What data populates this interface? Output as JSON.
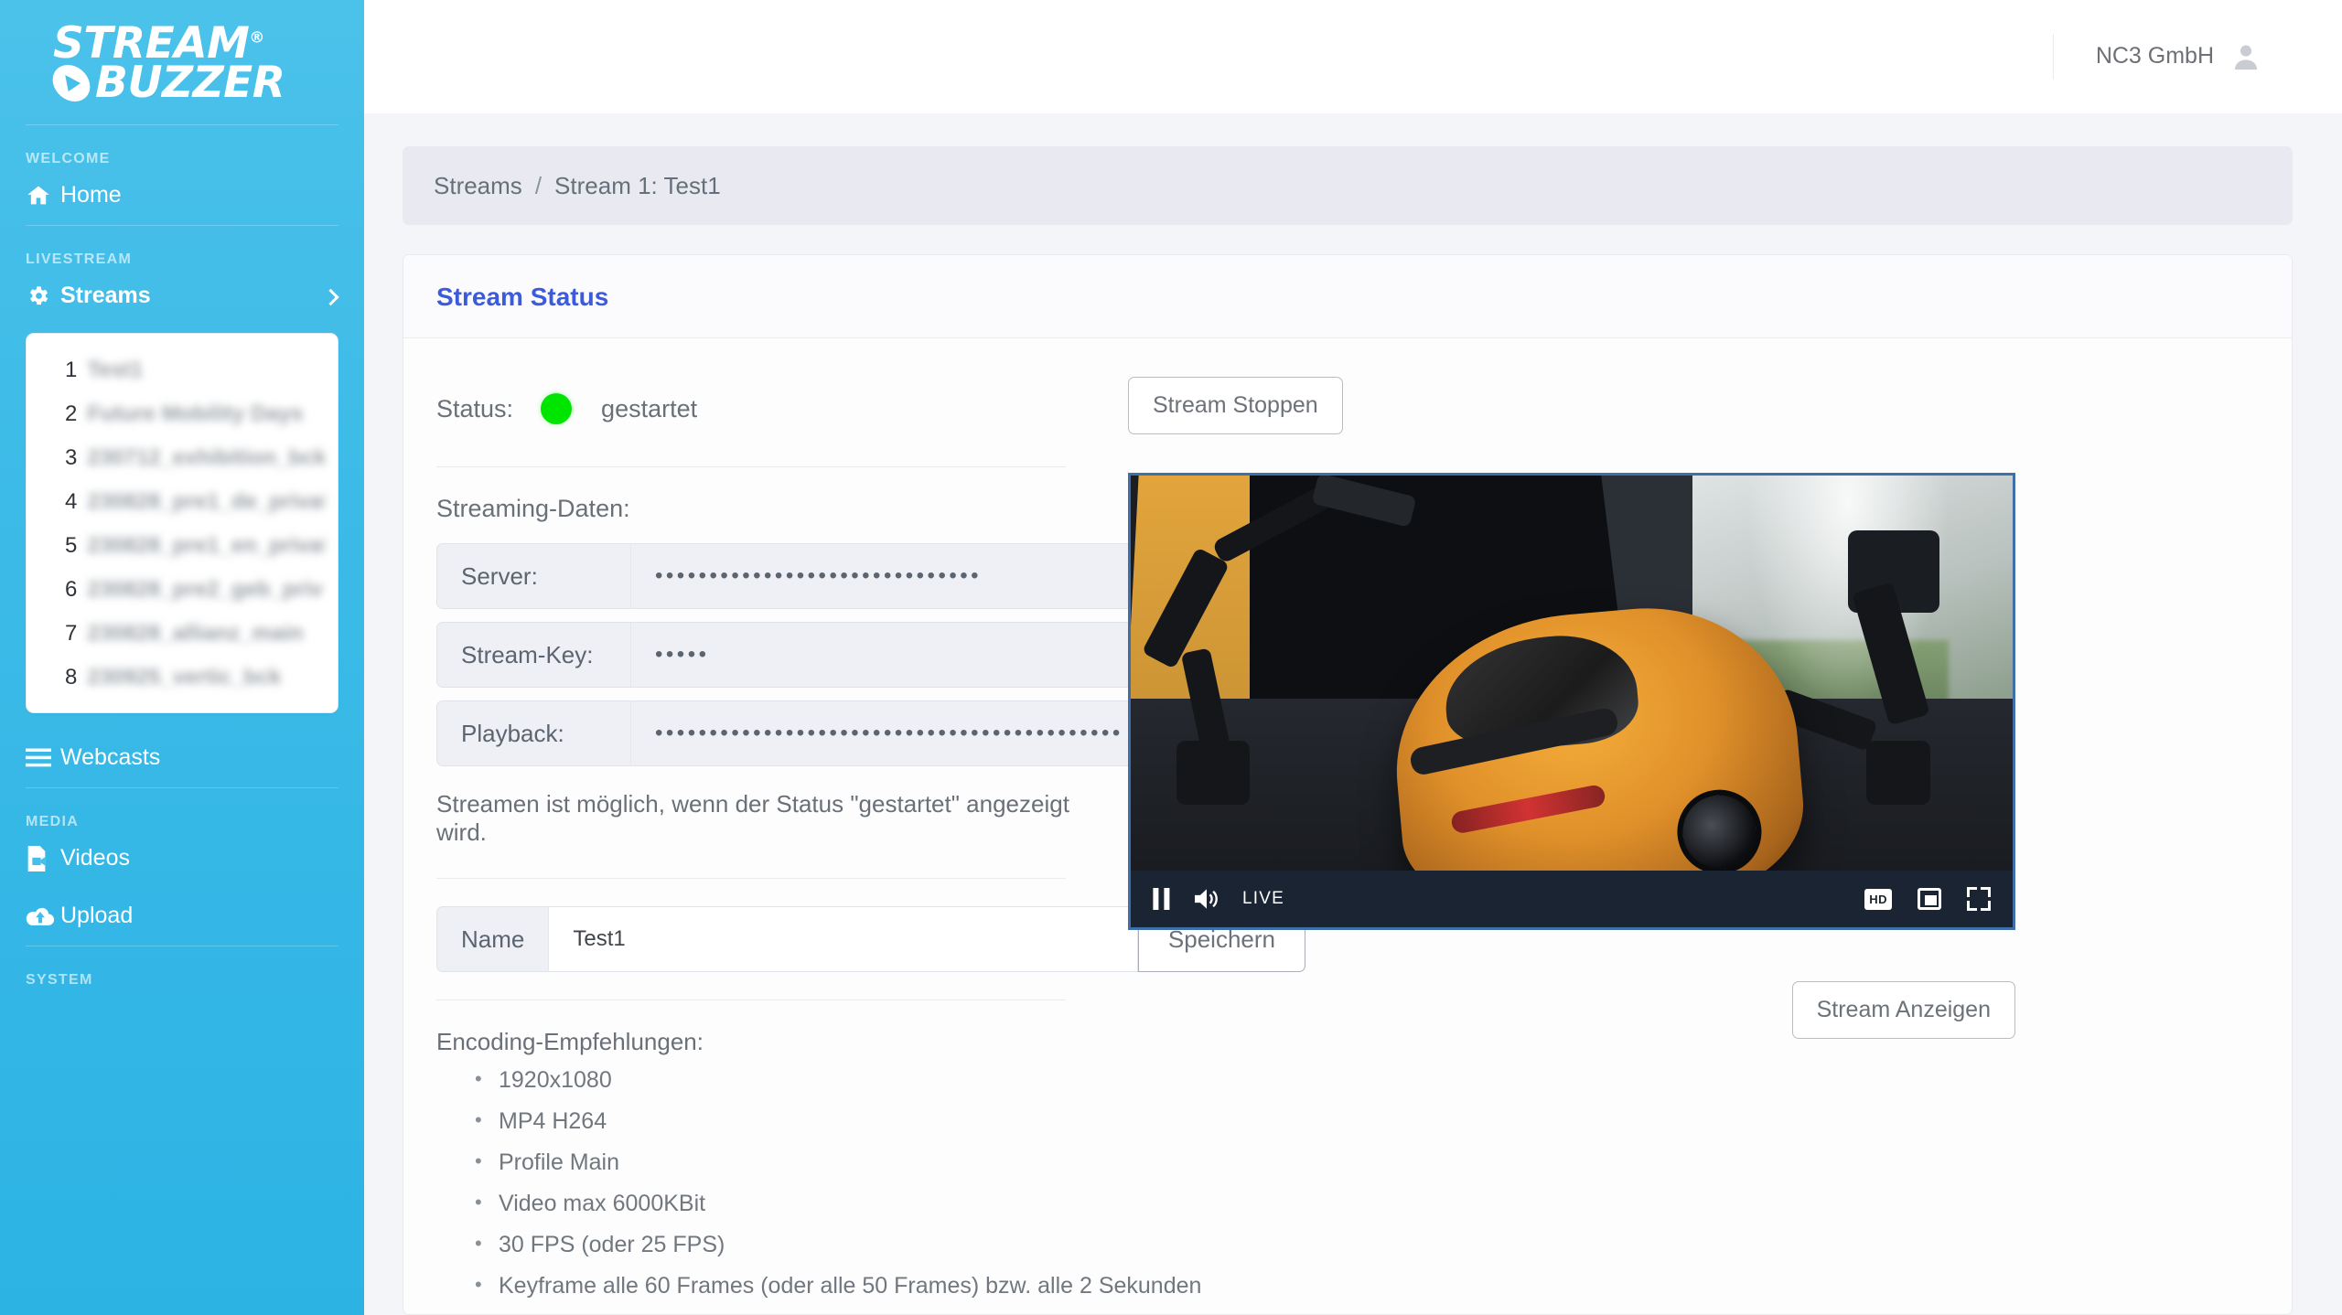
{
  "brand": {
    "line1": "STREAM",
    "line2": "BUZZER",
    "registered": "®",
    "play_icon": "play-icon"
  },
  "sidebar": {
    "sections": [
      {
        "label": "WELCOME"
      },
      {
        "label": "LIVESTREAM"
      },
      {
        "label": "MEDIA"
      },
      {
        "label": "SYSTEM"
      }
    ],
    "home": {
      "label": "Home",
      "icon": "home-icon"
    },
    "streams": {
      "label": "Streams",
      "icon": "gear-icon",
      "chevron": "chevron-right-icon"
    },
    "webcasts": {
      "label": "Webcasts",
      "icon": "list-icon"
    },
    "videos": {
      "label": "Videos",
      "icon": "video-file-icon"
    },
    "upload": {
      "label": "Upload",
      "icon": "cloud-upload-icon"
    },
    "stream_list": [
      {
        "num": "1",
        "name": "Test1"
      },
      {
        "num": "2",
        "name": "Future Mobility Days"
      },
      {
        "num": "3",
        "name": "230712_exhibition_bck"
      },
      {
        "num": "4",
        "name": "230828_pre1_de_privat"
      },
      {
        "num": "5",
        "name": "230828_pre1_en_privat"
      },
      {
        "num": "6",
        "name": "230828_pre2_geb_priv"
      },
      {
        "num": "7",
        "name": "230828_allianz_main"
      },
      {
        "num": "8",
        "name": "230925_vertic_bck"
      }
    ]
  },
  "topbar": {
    "user_name": "NC3 GmbH",
    "avatar_icon": "user-avatar-icon"
  },
  "breadcrumb": {
    "root": "Streams",
    "separator": "/",
    "current": "Stream 1: Test1"
  },
  "panel": {
    "title": "Stream Status",
    "status": {
      "label": "Status:",
      "value": "gestartet",
      "dot_color": "#00e500"
    },
    "stop_button": "Stream Stoppen",
    "streaming_data_label": "Streaming-Daten:",
    "fields": [
      {
        "label": "Server:",
        "value": "••••••••••••••••••••••••••••••",
        "eye_icon": "eye-icon"
      },
      {
        "label": "Stream-Key:",
        "value": "•••••",
        "eye_icon": "eye-icon"
      },
      {
        "label": "Playback:",
        "value": "•••••••••••••••••••••••••••••••••••••••••••",
        "eye_icon": "eye-icon"
      }
    ],
    "note": "Streamen ist möglich, wenn der Status \"gestartet\" angezeigt wird.",
    "name_field": {
      "label": "Name",
      "value": "Test1",
      "placeholder": "Name",
      "save_button": "Speichern"
    },
    "encoding": {
      "title": "Encoding-Empfehlungen:",
      "items": [
        "1920x1080",
        "MP4 H264",
        "Profile Main",
        "Video max 6000KBit",
        "30 FPS (oder 25 FPS)",
        "Keyframe alle 60 Frames (oder alle 50 Frames) bzw. alle 2 Sekunden"
      ]
    }
  },
  "player": {
    "pause_icon": "pause-icon",
    "volume_icon": "volume-icon",
    "live_label": "LIVE",
    "hd_label": "HD",
    "pip_icon": "picture-in-picture-icon",
    "fullscreen_icon": "fullscreen-icon",
    "show_button": "Stream Anzeigen"
  }
}
